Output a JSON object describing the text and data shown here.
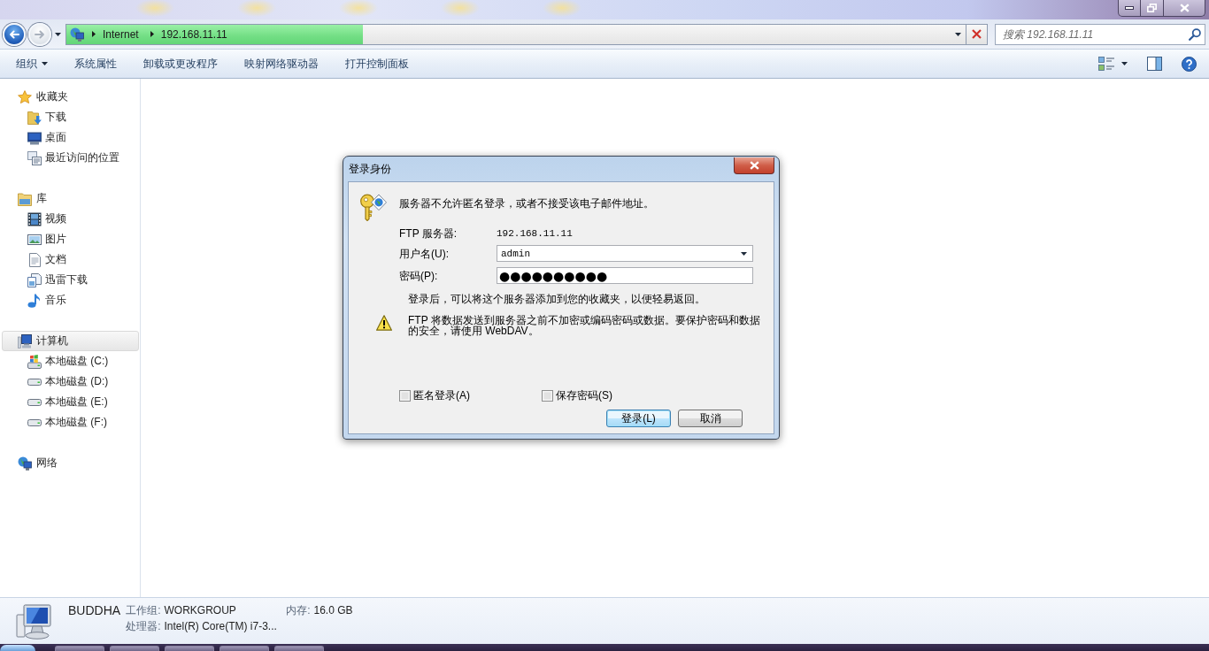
{
  "navigation": {
    "back": {
      "disabled": false
    },
    "forward": {
      "disabled": true
    }
  },
  "address_bar": {
    "segments": [
      "Internet",
      "192.168.11.11"
    ],
    "level": 0.33
  },
  "search": {
    "placeholder": "搜索 192.168.11.11"
  },
  "toolbar": {
    "items": [
      {
        "label": "组织",
        "kind": "menu"
      },
      {
        "label": "系统属性",
        "kind": "command"
      },
      {
        "label": "卸载或更改程序",
        "kind": "command"
      },
      {
        "label": "映射网络驱动器",
        "kind": "command"
      },
      {
        "label": "打开控制面板",
        "kind": "command"
      }
    ]
  },
  "sidebar": {
    "items": [
      {
        "label": "收藏夹",
        "kind": "favorites",
        "selected": false,
        "children": [
          {
            "label": "下载",
            "kind": "downloads",
            "selected": false
          },
          {
            "label": "桌面",
            "kind": "desktop",
            "selected": false
          },
          {
            "label": "最近访问的位置",
            "kind": "recent",
            "selected": false
          }
        ]
      },
      {
        "label": "库",
        "kind": "library",
        "selected": false,
        "children": [
          {
            "label": "视频",
            "kind": "video",
            "selected": false
          },
          {
            "label": "图片",
            "kind": "pictures",
            "selected": false
          },
          {
            "label": "文档",
            "kind": "documents",
            "selected": false
          },
          {
            "label": "迅雷下载",
            "kind": "pages",
            "selected": false
          },
          {
            "label": "音乐",
            "kind": "music",
            "selected": false
          }
        ]
      },
      {
        "label": "计算机",
        "kind": "computer",
        "selected": true,
        "children": [
          {
            "label": "本地磁盘 (C:)",
            "kind": "system-drive",
            "selected": false
          },
          {
            "label": "本地磁盘 (D:)",
            "kind": "drive",
            "selected": false
          },
          {
            "label": "本地磁盘 (E:)",
            "kind": "drive",
            "selected": false
          },
          {
            "label": "本地磁盘 (F:)",
            "kind": "drive",
            "selected": false
          }
        ]
      },
      {
        "label": "网络",
        "kind": "network",
        "selected": false
      }
    ]
  },
  "dialog": {
    "title": "登录身份",
    "message": "服务器不允许匿名登录，或者不接受该电子邮件地址。",
    "fields": [
      {
        "label": "FTP 服务器:",
        "kind": "text",
        "value": "192.168.11.11"
      },
      {
        "label": "用户名(U):",
        "kind": "combo",
        "value": "admin"
      },
      {
        "label": "密码(P):",
        "kind": "password",
        "value": "●●●●●●●●●●"
      }
    ],
    "note": "登录后，可以将这个服务器添加到您的收藏夹，以便轻易返回。",
    "warning": "FTP 将数据发送到服务器之前不加密或编码密码或数据。要保护密码和数据的安全，请使用 WebDAV。",
    "checkboxes": [
      {
        "label": "匿名登录(A)",
        "checked": false
      },
      {
        "label": "保存密码(S)",
        "checked": false
      }
    ],
    "buttons": [
      {
        "label": "登录(L)",
        "default": true
      },
      {
        "label": "取消",
        "default": false
      }
    ]
  },
  "details": {
    "name": "BUDDHA",
    "fields": [
      {
        "label": "工作组:",
        "value": "WORKGROUP"
      },
      {
        "label": "内存:",
        "value": "16.0 GB"
      },
      {
        "label": "处理器:",
        "value": "Intel(R) Core(TM) i7-3..."
      }
    ]
  }
}
